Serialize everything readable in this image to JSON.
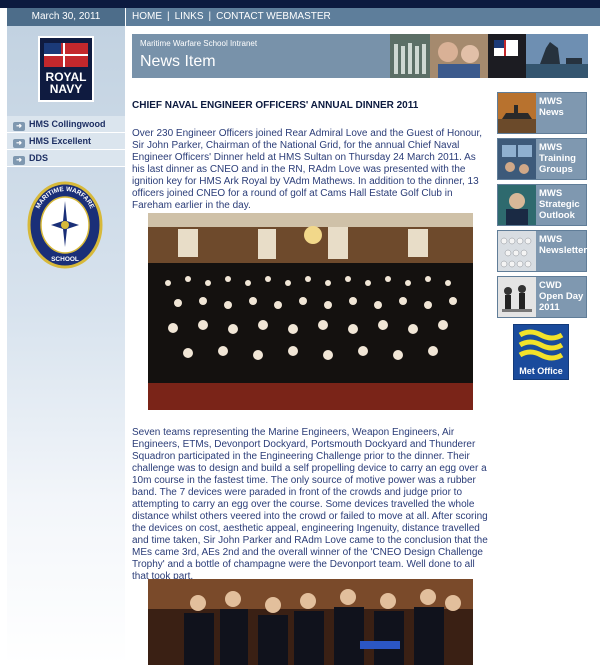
{
  "header": {
    "date": "March 30, 2011",
    "nav": [
      "HOME",
      "LINKS",
      "CONTACT WEBMASTER"
    ],
    "nav_separator": "|"
  },
  "sidebar": {
    "logo_text": [
      "ROYAL",
      "NAVY"
    ],
    "items": [
      {
        "label": "HMS Collingwood",
        "active": true
      },
      {
        "label": "HMS Excellent",
        "active": false
      },
      {
        "label": "DDS",
        "active": false
      }
    ],
    "badge_text": [
      "MARITIME WARFARE",
      "SCHOOL"
    ]
  },
  "banner": {
    "subtitle": "Maritime Warfare School Intranet",
    "title": "News Item"
  },
  "article": {
    "headline": "CHIEF NAVAL ENGINEER OFFICERS' ANNUAL DINNER 2011",
    "para1": "Over 230 Engineer Officers joined Rear Admiral Love and the Guest of Honour, Sir John Parker, Chairman of the National Grid, for the annual Chief Naval Engineer Officers' Dinner held at HMS Sultan on Thursday 24 March 2011.  As his last dinner as CNEO and in the RN, RAdm Love was presented with the ignition key for HMS Ark Royal by VAdm Mathews.  In addition to the dinner, 13 officers joined CNEO for a round of golf at Cams Hall Estate Golf Club in Fareham earlier in the day.",
    "para2": "Seven teams representing the Marine Engineers, Weapon Engineers, Air Engineers, ETMs, Devonport Dockyard, Portsmouth Dockyard and Thunderer Squadron participated in the Engineering Challenge prior to the dinner. Their challenge was to design and build a self propelling device to carry an egg over a 10m course in the fastest time.  The only source of motive power was a rubber band.  The 7 devices were paraded in front of the crowds and judge prior to attempting to carry an egg over the course.  Some devices travelled the whole distance whilst others veered into the crowd or failed to move at all. After scoring the devices on cost, aesthetic appeal, engineering Ingenuity, distance travelled and time taken, Sir John Parker and RAdm Love came to the conclusion that the MEs came 3rd, AEs 2nd and the overall winner of the 'CNEO Design Challenge Trophy' and a bottle of champagne were the Devonport team. Well done to all that took part."
  },
  "right_nav": [
    {
      "label": "MWS News",
      "thumb": "ships-icon"
    },
    {
      "label": "MWS Training Groups",
      "thumb": "training-icon"
    },
    {
      "label": "MWS Strategic Outlook",
      "thumb": "outlook-icon"
    },
    {
      "label": "MWS Newsletter",
      "thumb": "newsletter-icon"
    },
    {
      "label": "CWD Open Day 2011",
      "thumb": "openday-icon"
    }
  ],
  "met_office": {
    "label": "Met Office"
  },
  "colors": {
    "navy": "#0c1a3f",
    "nav_blue": "#5e7e9b",
    "tile_blue": "#7f98b0",
    "text_blue": "#2b3d78"
  }
}
